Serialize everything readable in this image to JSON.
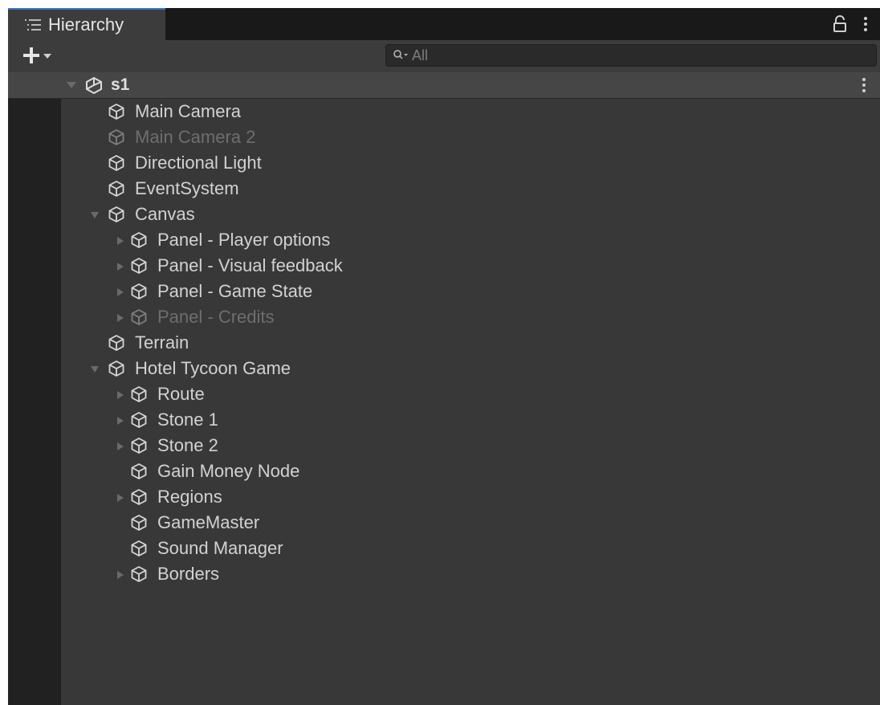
{
  "window": {
    "tab": {
      "title": "Hierarchy",
      "icon": "list-icon"
    },
    "header_icons": [
      "lock-icon",
      "kebab-menu-icon"
    ]
  },
  "toolbar": {
    "add_button_icon": "plus-dropdown-icon",
    "search": {
      "placeholder": "All",
      "icon": "search-icon"
    }
  },
  "scene": {
    "name": "s1",
    "icon": "unity-scene-icon",
    "expanded": true
  },
  "tree": [
    {
      "label": "Main Camera",
      "depth": 1,
      "foldout": "none",
      "active": true,
      "name": "main-camera"
    },
    {
      "label": "Main Camera 2",
      "depth": 1,
      "foldout": "none",
      "active": false,
      "name": "main-camera-2"
    },
    {
      "label": "Directional Light",
      "depth": 1,
      "foldout": "none",
      "active": true,
      "name": "directional-light"
    },
    {
      "label": "EventSystem",
      "depth": 1,
      "foldout": "none",
      "active": true,
      "name": "eventsystem"
    },
    {
      "label": "Canvas",
      "depth": 1,
      "foldout": "expanded",
      "active": true,
      "name": "canvas"
    },
    {
      "label": "Panel - Player options",
      "depth": 2,
      "foldout": "collapsed",
      "active": true,
      "name": "panel-player-options"
    },
    {
      "label": "Panel - Visual feedback",
      "depth": 2,
      "foldout": "collapsed",
      "active": true,
      "name": "panel-visual-feedback"
    },
    {
      "label": "Panel - Game State",
      "depth": 2,
      "foldout": "collapsed",
      "active": true,
      "name": "panel-game-state"
    },
    {
      "label": "Panel - Credits",
      "depth": 2,
      "foldout": "collapsed",
      "active": false,
      "name": "panel-credits"
    },
    {
      "label": "Terrain",
      "depth": 1,
      "foldout": "none",
      "active": true,
      "name": "terrain"
    },
    {
      "label": "Hotel Tycoon Game",
      "depth": 1,
      "foldout": "expanded",
      "active": true,
      "name": "hotel-tycoon-game"
    },
    {
      "label": "Route",
      "depth": 2,
      "foldout": "collapsed",
      "active": true,
      "name": "route"
    },
    {
      "label": "Stone 1",
      "depth": 2,
      "foldout": "collapsed",
      "active": true,
      "name": "stone-1"
    },
    {
      "label": "Stone 2",
      "depth": 2,
      "foldout": "collapsed",
      "active": true,
      "name": "stone-2"
    },
    {
      "label": "Gain Money Node",
      "depth": 2,
      "foldout": "none",
      "active": true,
      "name": "gain-money-node"
    },
    {
      "label": "Regions",
      "depth": 2,
      "foldout": "collapsed",
      "active": true,
      "name": "regions"
    },
    {
      "label": "GameMaster",
      "depth": 2,
      "foldout": "none",
      "active": true,
      "name": "gamemaster"
    },
    {
      "label": "Sound Manager",
      "depth": 2,
      "foldout": "none",
      "active": true,
      "name": "sound-manager"
    },
    {
      "label": "Borders",
      "depth": 2,
      "foldout": "collapsed",
      "active": true,
      "name": "borders"
    }
  ],
  "colors": {
    "panel_bg": "#383838",
    "gutter_bg": "#212121",
    "scene_row_bg": "#464646",
    "tab_accent": "#3a79bb",
    "text": "#d2d2d2",
    "text_inactive": "#6e6e6e"
  }
}
